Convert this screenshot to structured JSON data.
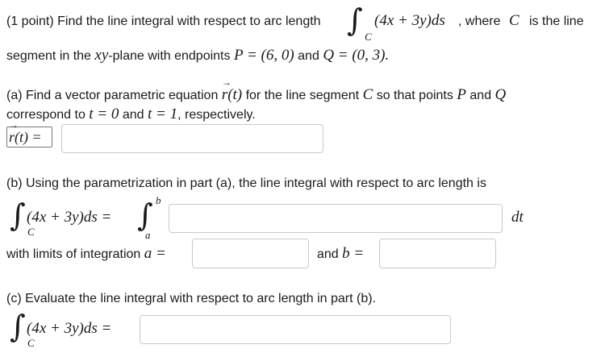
{
  "intro": {
    "points": "(1 point)",
    "text1": "Find the line integral with respect to arc length",
    "integrand": "(4x + 3y)ds",
    "text2": ", where",
    "curve": "C",
    "text3": "is the line",
    "line2a": "segment in the",
    "plane": "xy",
    "line2b": "-plane with endpoints",
    "P": "P = (6, 0)",
    "and": "and",
    "Q": "Q = (0, 3)."
  },
  "part_a": {
    "text1": "(a) Find a vector parametric equation",
    "rt": "r(t)",
    "text2": "for the line segment",
    "C": "C",
    "text3": "so that points",
    "P": "P",
    "and": "and",
    "Q": "Q",
    "line2": "correspond to",
    "t0": "t = 0",
    "and2": "and",
    "t1": "t = 1",
    "tail": ", respectively.",
    "label": "r(t) =",
    "input_value": ""
  },
  "part_b": {
    "text": "(b) Using the parametrization in part (a), the line integral with respect to arc length is",
    "integrand": "(4x + 3y)ds =",
    "sub_C": "C",
    "upper": "b",
    "lower": "a",
    "dt": "dt",
    "limits_text": "with limits of integration",
    "a_eq": "a =",
    "and_b": "and",
    "b_eq": "b =",
    "integral_value": "",
    "a_value": "",
    "b_value": ""
  },
  "part_c": {
    "text": "(c) Evaluate the line integral with respect to arc length in part (b).",
    "integrand": "(4x + 3y)ds =",
    "sub_C": "C",
    "value": ""
  }
}
